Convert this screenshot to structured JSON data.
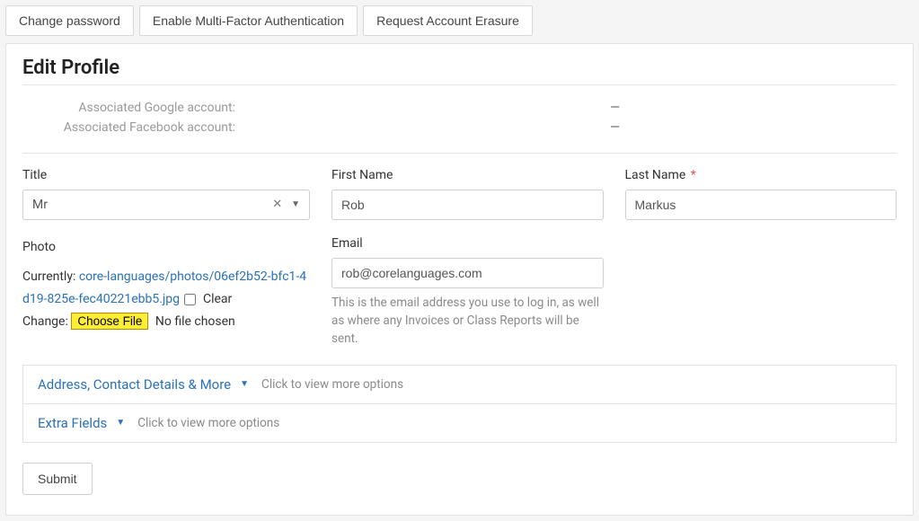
{
  "topnav": {
    "change_password": "Change password",
    "enable_mfa": "Enable Multi-Factor Authentication",
    "request_erasure": "Request Account Erasure"
  },
  "page": {
    "title": "Edit Profile"
  },
  "associated": {
    "google_label": "Associated Google account:",
    "google_value": "—",
    "facebook_label": "Associated Facebook account:",
    "facebook_value": "—"
  },
  "fields": {
    "title": {
      "label": "Title",
      "value": "Mr"
    },
    "first_name": {
      "label": "First Name",
      "value": "Rob"
    },
    "last_name": {
      "label": "Last Name",
      "value": "Markus"
    },
    "photo": {
      "label": "Photo",
      "currently_label": "Currently:",
      "currently_link": "core-languages/photos/06ef2b52-bfc1-4d19-825e-fec40221ebb5.jpg",
      "clear_label": "Clear",
      "change_label": "Change:",
      "choose_file": "Choose File",
      "no_file": "No file chosen"
    },
    "email": {
      "label": "Email",
      "value": "rob@corelanguages.com",
      "help": "This is the email address you use to log in, as well as where any Invoices or Class Reports will be sent."
    }
  },
  "accordion": {
    "address": {
      "title": "Address, Contact Details & More",
      "sub": "Click to view more options"
    },
    "extra": {
      "title": "Extra Fields",
      "sub": "Click to view more options"
    }
  },
  "submit_label": "Submit",
  "required_mark": "*"
}
